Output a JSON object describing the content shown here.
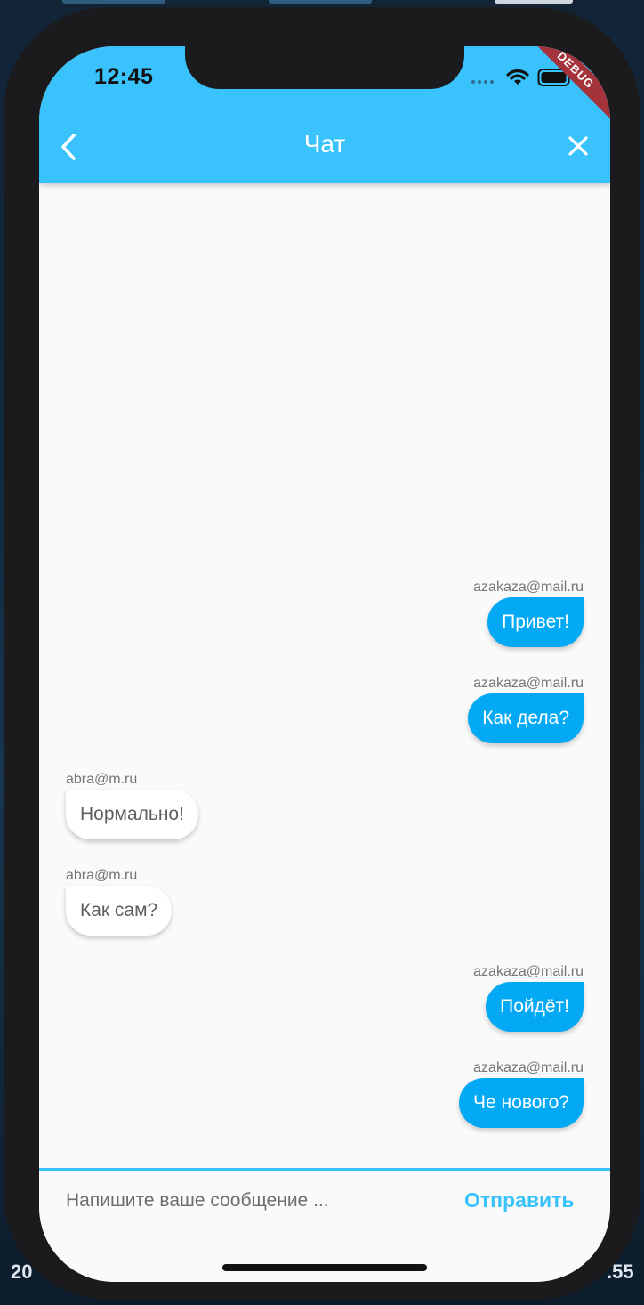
{
  "status_bar": {
    "time": "12:45",
    "debug_banner": "DEBUG"
  },
  "app_bar": {
    "title": "Чат",
    "back_icon": "chevron-left-icon",
    "close_icon": "close-icon"
  },
  "messages": [
    {
      "sender": "azakaza@mail.ru",
      "text": "Привет!",
      "is_me": true
    },
    {
      "sender": "azakaza@mail.ru",
      "text": "Как дела?",
      "is_me": true
    },
    {
      "sender": "abra@m.ru",
      "text": "Нормально!",
      "is_me": false
    },
    {
      "sender": "abra@m.ru",
      "text": "Как сам?",
      "is_me": false
    },
    {
      "sender": "azakaza@mail.ru",
      "text": "Пойдёт!",
      "is_me": true
    },
    {
      "sender": "azakaza@mail.ru",
      "text": "Че нового?",
      "is_me": true
    }
  ],
  "composer": {
    "placeholder": "Напишите ваше сообщение ...",
    "value": "",
    "send_label": "Отправить"
  },
  "background_edges": {
    "left_text": "20",
    "right_text": ".55"
  },
  "colors": {
    "accent": "#39c2fb",
    "my_bubble": "#03a9f4",
    "their_bubble": "#ffffff"
  }
}
